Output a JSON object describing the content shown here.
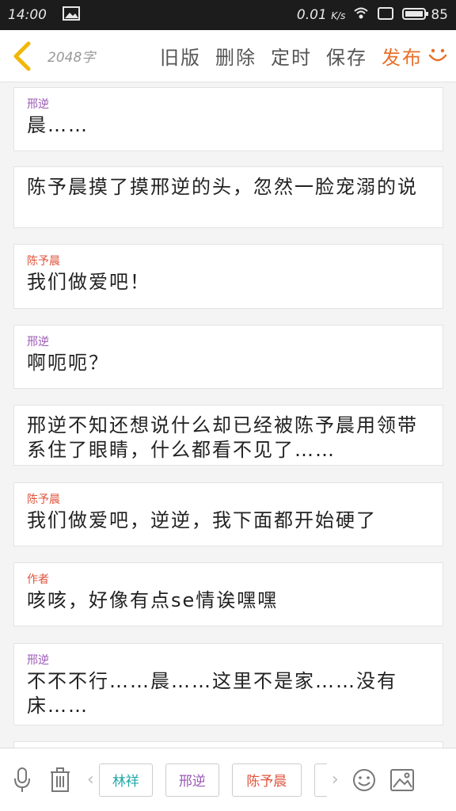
{
  "status": {
    "time": "14:00",
    "speed": "0.01",
    "speed_unit": "K/s",
    "battery": "85"
  },
  "toolbar": {
    "word_count": "2048字",
    "actions": [
      "旧版",
      "删除",
      "定时",
      "保存"
    ],
    "publish": "发布"
  },
  "colors": {
    "accent": "#e8702a",
    "xingni": "#9b59b6",
    "chenyuchen": "#e0533d",
    "author": "#e0533d",
    "linyang": "#22a7a7"
  },
  "cards": [
    {
      "speaker": "邢逆",
      "text": "晨……"
    },
    {
      "speaker": "",
      "text": "陈予晨摸了摸邢逆的头，忽然一脸宠溺的说"
    },
    {
      "speaker": "陈予晨",
      "text": "我们做爱吧！"
    },
    {
      "speaker": "邢逆",
      "text": "啊呃呃？"
    },
    {
      "speaker": "",
      "text": "邢逆不知还想说什么却已经被陈予晨用领带系住了眼睛，什么都看不见了……"
    },
    {
      "speaker": "陈予晨",
      "text": "我们做爱吧，逆逆，我下面都开始硬了"
    },
    {
      "speaker": "作者",
      "text": "咳咳，好像有点se情诶嘿嘿"
    },
    {
      "speaker": "邢逆",
      "text": "不不不行……晨……这里不是家……没有床……"
    }
  ],
  "bottom": {
    "tags": [
      "林祥",
      "邢逆",
      "陈予晨"
    ]
  }
}
